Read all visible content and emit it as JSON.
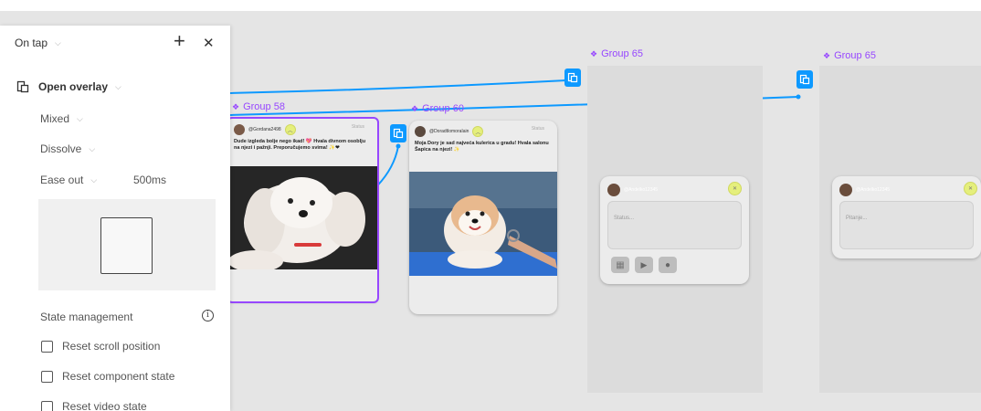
{
  "panel": {
    "trigger": "On tap",
    "add_symbol": "+",
    "close_symbol": "✕",
    "action": "Open overlay",
    "position": "Mixed",
    "animation": "Dissolve",
    "easing": "Ease out",
    "duration": "500ms",
    "state_management_label": "State management",
    "info_symbol": "i",
    "checkboxes": [
      {
        "label": "Reset scroll position",
        "checked": false
      },
      {
        "label": "Reset component state",
        "checked": false
      },
      {
        "label": "Reset video state",
        "checked": false
      }
    ]
  },
  "canvas": {
    "frames": [
      {
        "label": "Group 58"
      },
      {
        "label": "Group 60"
      },
      {
        "label": "Group 65"
      },
      {
        "label": "Group 65"
      }
    ],
    "posts": [
      {
        "username": "@Gordana2498",
        "status": "Status",
        "text": "Dude izgleda bolje nego ikad! 💖 Hvala divnom osoblju na njezi i pažnji. Preporučujemo svima! ✨❤"
      },
      {
        "username": "@DoradtlomoraIain",
        "status": "Status",
        "text": "Moja Dory je sad najveća kulerica u gradu! Hvala salonu Šapica na njezi! ✨"
      }
    ],
    "composers": [
      {
        "username": "@Andelko12345",
        "placeholder": "Status..."
      },
      {
        "username": "@Andelko12345",
        "placeholder": "Pitanje..."
      }
    ]
  },
  "colors": {
    "prototype_blue": "#0d99ff",
    "frame_purple": "#9747ff",
    "yellow_button": "#e5ef7c"
  }
}
